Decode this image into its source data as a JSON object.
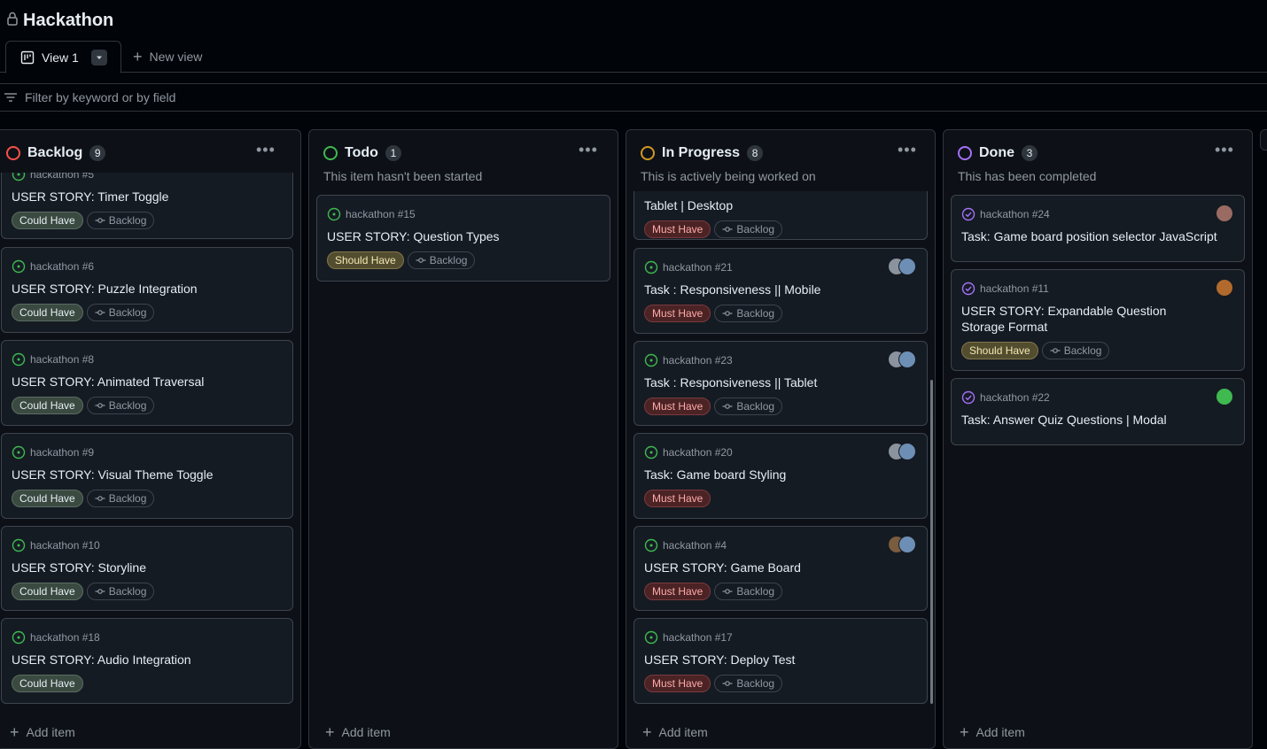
{
  "project": {
    "title": "Hackathon"
  },
  "tabs": {
    "view_label": "View 1",
    "new_view_label": "New view"
  },
  "filter": {
    "placeholder": "Filter by keyword or by field"
  },
  "columns": [
    {
      "name": "Backlog",
      "count": "9",
      "color": "#f85149",
      "description": "",
      "cards": [
        {
          "ref": "hackathon #5",
          "title": "USER STORY: Timer Toggle",
          "priority": "Could Have",
          "iteration": "Backlog"
        },
        {
          "ref": "hackathon #6",
          "title": "USER STORY: Puzzle Integration",
          "priority": "Could Have",
          "iteration": "Backlog"
        },
        {
          "ref": "hackathon #8",
          "title": "USER STORY: Animated Traversal",
          "priority": "Could Have",
          "iteration": "Backlog"
        },
        {
          "ref": "hackathon #9",
          "title": "USER STORY: Visual Theme Toggle",
          "priority": "Could Have",
          "iteration": "Backlog"
        },
        {
          "ref": "hackathon #10",
          "title": "USER STORY: Storyline",
          "priority": "Could Have",
          "iteration": "Backlog"
        },
        {
          "ref": "hackathon #18",
          "title": "USER STORY: Audio Integration",
          "priority": "Could Have",
          "iteration": ""
        }
      ],
      "add_label": "Add item"
    },
    {
      "name": "Todo",
      "count": "1",
      "color": "#3fb950",
      "description": "This item hasn't been started",
      "cards": [
        {
          "ref": "hackathon #15",
          "title": "USER STORY: Question Types",
          "priority": "Should Have",
          "iteration": "Backlog"
        }
      ],
      "add_label": "Add item"
    },
    {
      "name": "In Progress",
      "count": "8",
      "color": "#d29922",
      "description": "This is actively being worked on",
      "cards": [
        {
          "ref": "",
          "title": "Tablet | Desktop",
          "priority": "Must Have",
          "iteration": "Backlog"
        },
        {
          "ref": "hackathon #21",
          "title": "Task : Responsiveness || Mobile",
          "priority": "Must Have",
          "iteration": "Backlog"
        },
        {
          "ref": "hackathon #23",
          "title": "Task : Responsiveness || Tablet",
          "priority": "Must Have",
          "iteration": "Backlog"
        },
        {
          "ref": "hackathon #20",
          "title": "Task: Game board Styling",
          "priority": "Must Have",
          "iteration": ""
        },
        {
          "ref": "hackathon #4",
          "title": "USER STORY: Game Board",
          "priority": "Must Have",
          "iteration": "Backlog"
        },
        {
          "ref": "hackathon #17",
          "title": "USER STORY: Deploy Test",
          "priority": "Must Have",
          "iteration": "Backlog"
        }
      ],
      "add_label": "Add item"
    },
    {
      "name": "Done",
      "count": "3",
      "color": "#a371f7",
      "description": "This has been completed",
      "cards": [
        {
          "ref": "hackathon #24",
          "title": "Task: Game board position selector JavaScript",
          "priority": "",
          "iteration": ""
        },
        {
          "ref": "hackathon #11",
          "title": "USER STORY: Expandable Question Storage Format",
          "priority": "Should Have",
          "iteration": "Backlog"
        },
        {
          "ref": "hackathon #22",
          "title": "Task: Answer Quiz Questions | Modal",
          "priority": "",
          "iteration": ""
        }
      ],
      "add_label": "Add item"
    }
  ]
}
